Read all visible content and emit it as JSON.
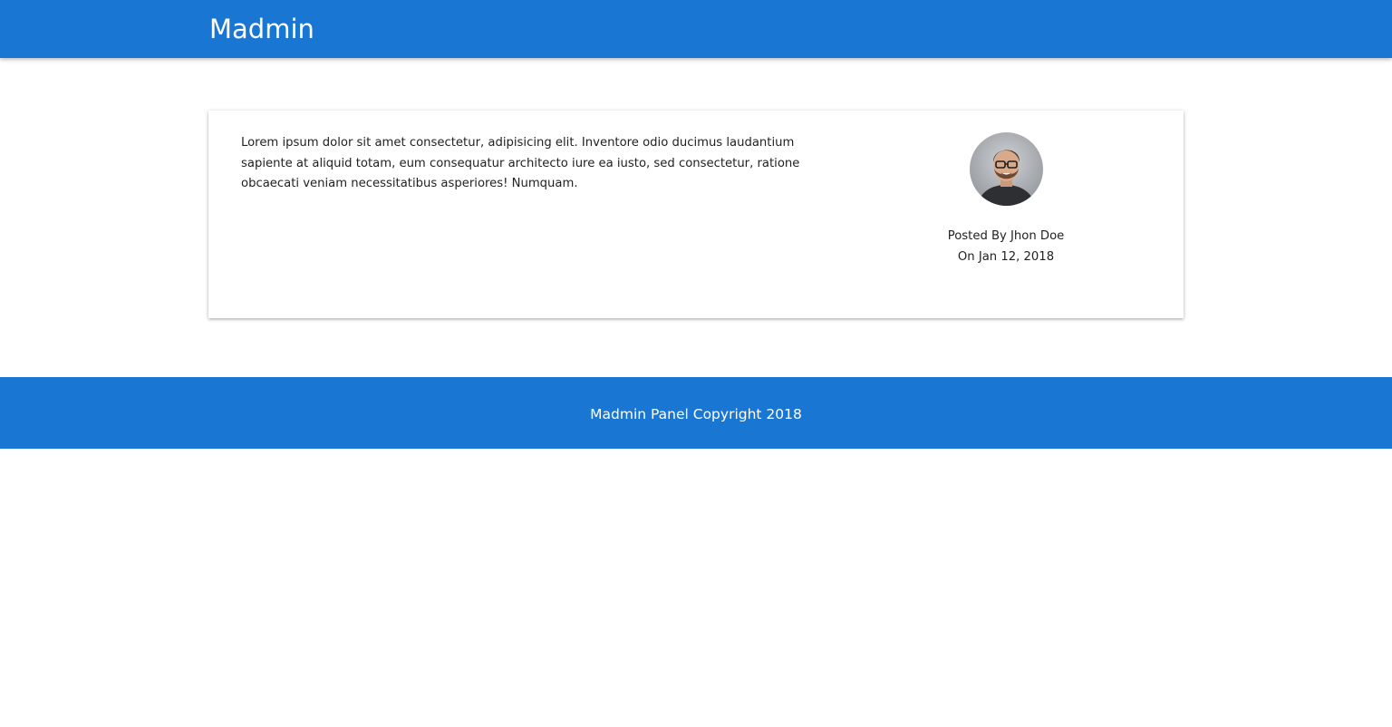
{
  "navbar": {
    "brand": "Madmin"
  },
  "post": {
    "body": "Lorem ipsum dolor sit amet consectetur, adipisicing elit. Inventore odio ducimus laudantium sapiente at aliquid totam, eum consequatur architecto iure ea iusto, sed consectetur, ratione obcaecati veniam necessitatibus asperiores! Numquam.",
    "posted_by": "Posted By Jhon Doe",
    "posted_on": "On Jan 12, 2018",
    "avatar_icon": "user-photo"
  },
  "footer": {
    "copyright": "Madmin Panel Copyright 2018"
  },
  "colors": {
    "primary": "#1976d2",
    "background": "#ffffff",
    "text": "#222222"
  }
}
